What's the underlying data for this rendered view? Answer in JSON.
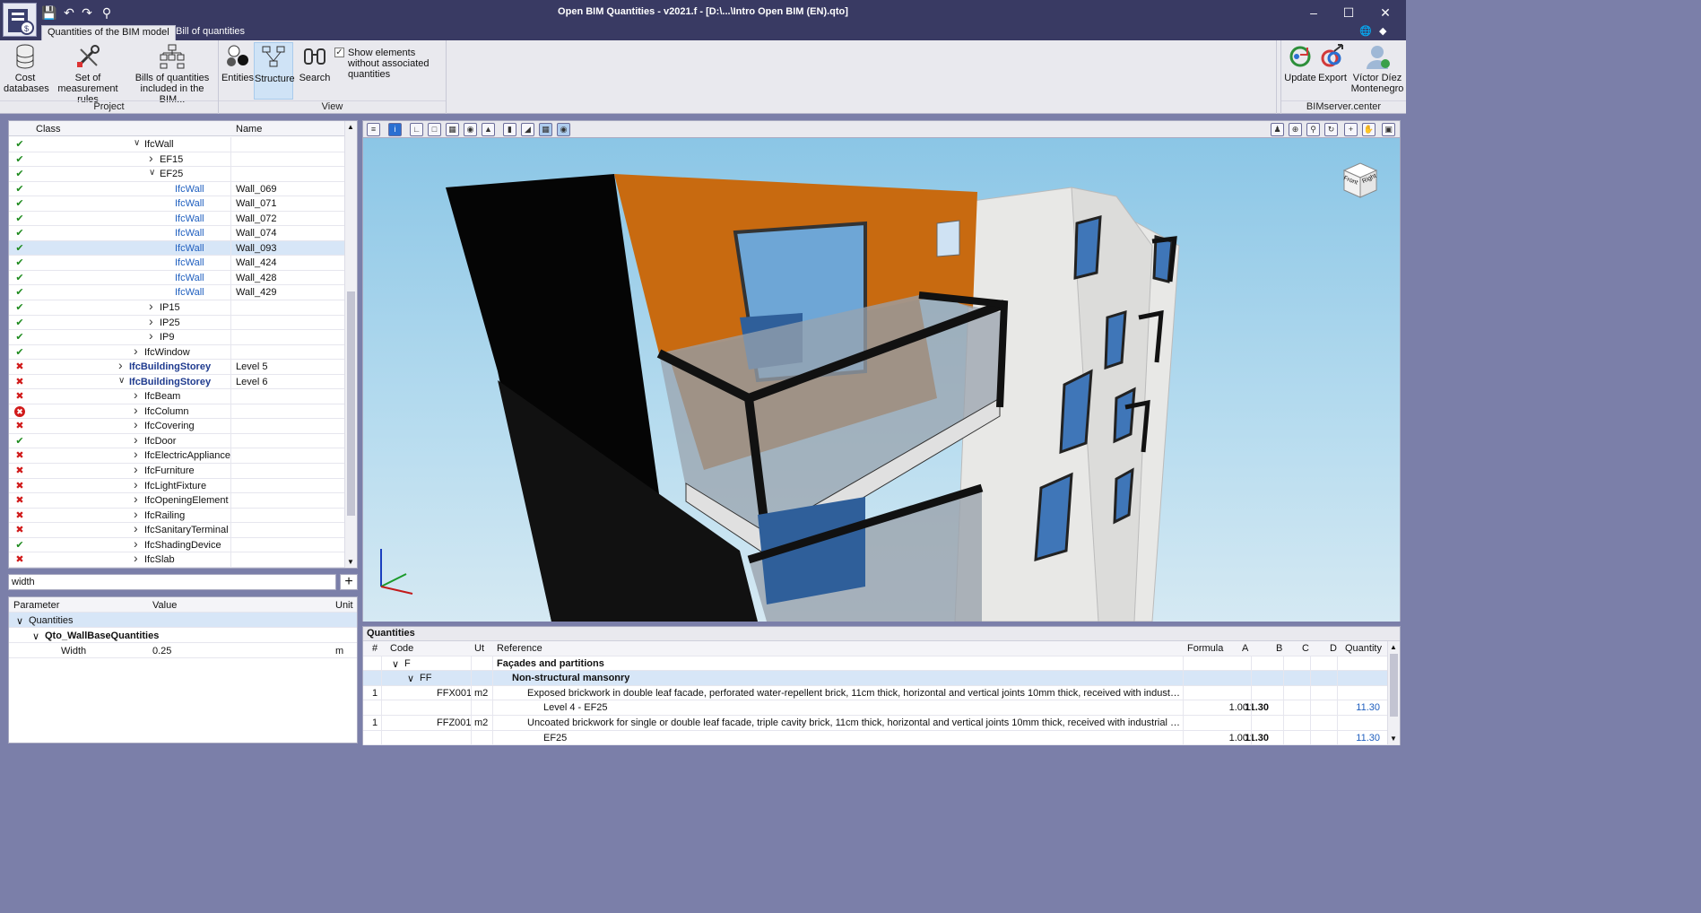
{
  "app": {
    "title": "Open BIM Quantities - v2021.f - [D:\\...\\Intro Open BIM (EN).qto]",
    "window_controls": [
      "minimize-icon",
      "maximize-icon",
      "close-icon"
    ]
  },
  "tabs": [
    {
      "label": "Quantities of the BIM model",
      "active": true
    },
    {
      "label": "Bill of quantities",
      "active": false
    }
  ],
  "ribbon": {
    "project": {
      "label": "Project",
      "buttons": [
        {
          "label": "Cost databases",
          "icon": "database-icon"
        },
        {
          "label": "Set of measurement rules",
          "icon": "tools-icon"
        },
        {
          "label": "Bills of quantities included in the BIM...",
          "icon": "bill-structure-icon"
        }
      ]
    },
    "view": {
      "label": "View",
      "buttons": [
        {
          "label": "Entities",
          "icon": "entities-icon"
        },
        {
          "label": "Structure",
          "icon": "structure-icon",
          "active": true
        },
        {
          "label": "Search",
          "icon": "binoculars-icon"
        }
      ],
      "show_without_quantities": {
        "label": "Show elements without associated quantities",
        "checked": true
      }
    },
    "bimserver": {
      "label": "BIMserver.center",
      "buttons": [
        {
          "label": "Update",
          "icon": "update-icon"
        },
        {
          "label": "Export",
          "icon": "export-icon"
        },
        {
          "label": "Víctor Díez Montenegro",
          "icon": "user-icon"
        }
      ]
    }
  },
  "tree": {
    "headers": {
      "class": "Class",
      "name": "Name"
    },
    "rows": [
      {
        "status": "ok",
        "level": 6,
        "arrow": "down",
        "cls": "IfcWall",
        "name": "",
        "style": "normal"
      },
      {
        "status": "ok",
        "level": 7,
        "arrow": "right",
        "cls": "EF15",
        "name": "",
        "style": "normal"
      },
      {
        "status": "ok",
        "level": 7,
        "arrow": "down",
        "cls": "EF25",
        "name": "",
        "style": "normal"
      },
      {
        "status": "ok",
        "level": 8,
        "arrow": "",
        "cls": "IfcWall",
        "name": "Wall_069",
        "style": "link"
      },
      {
        "status": "ok",
        "level": 8,
        "arrow": "",
        "cls": "IfcWall",
        "name": "Wall_071",
        "style": "link"
      },
      {
        "status": "ok",
        "level": 8,
        "arrow": "",
        "cls": "IfcWall",
        "name": "Wall_072",
        "style": "link"
      },
      {
        "status": "ok",
        "level": 8,
        "arrow": "",
        "cls": "IfcWall",
        "name": "Wall_074",
        "style": "link"
      },
      {
        "status": "ok",
        "level": 8,
        "arrow": "",
        "cls": "IfcWall",
        "name": "Wall_093",
        "style": "link",
        "selected": true
      },
      {
        "status": "ok",
        "level": 8,
        "arrow": "",
        "cls": "IfcWall",
        "name": "Wall_424",
        "style": "link"
      },
      {
        "status": "ok",
        "level": 8,
        "arrow": "",
        "cls": "IfcWall",
        "name": "Wall_428",
        "style": "link"
      },
      {
        "status": "ok",
        "level": 8,
        "arrow": "",
        "cls": "IfcWall",
        "name": "Wall_429",
        "style": "link"
      },
      {
        "status": "ok",
        "level": 7,
        "arrow": "right",
        "cls": "IP15",
        "name": "",
        "style": "normal"
      },
      {
        "status": "ok",
        "level": 7,
        "arrow": "right",
        "cls": "IP25",
        "name": "",
        "style": "normal"
      },
      {
        "status": "ok",
        "level": 7,
        "arrow": "right",
        "cls": "IP9",
        "name": "",
        "style": "normal"
      },
      {
        "status": "ok",
        "level": 6,
        "arrow": "right",
        "cls": "IfcWindow",
        "name": "",
        "style": "normal"
      },
      {
        "status": "no",
        "level": 5,
        "arrow": "right",
        "cls": "IfcBuildingStorey",
        "name": "Level 5",
        "style": "bold"
      },
      {
        "status": "no",
        "level": 5,
        "arrow": "down",
        "cls": "IfcBuildingStorey",
        "name": "Level 6",
        "style": "bold"
      },
      {
        "status": "no",
        "level": 6,
        "arrow": "right",
        "cls": "IfcBeam",
        "name": "",
        "style": "normal"
      },
      {
        "status": "err",
        "level": 6,
        "arrow": "right",
        "cls": "IfcColumn",
        "name": "",
        "style": "normal"
      },
      {
        "status": "no",
        "level": 6,
        "arrow": "right",
        "cls": "IfcCovering",
        "name": "",
        "style": "normal"
      },
      {
        "status": "ok",
        "level": 6,
        "arrow": "right",
        "cls": "IfcDoor",
        "name": "",
        "style": "normal"
      },
      {
        "status": "no",
        "level": 6,
        "arrow": "right",
        "cls": "IfcElectricAppliance",
        "name": "",
        "style": "normal"
      },
      {
        "status": "no",
        "level": 6,
        "arrow": "right",
        "cls": "IfcFurniture",
        "name": "",
        "style": "normal"
      },
      {
        "status": "no",
        "level": 6,
        "arrow": "right",
        "cls": "IfcLightFixture",
        "name": "",
        "style": "normal"
      },
      {
        "status": "no",
        "level": 6,
        "arrow": "right",
        "cls": "IfcOpeningElement",
        "name": "",
        "style": "normal"
      },
      {
        "status": "no",
        "level": 6,
        "arrow": "right",
        "cls": "IfcRailing",
        "name": "",
        "style": "normal"
      },
      {
        "status": "no",
        "level": 6,
        "arrow": "right",
        "cls": "IfcSanitaryTerminal",
        "name": "",
        "style": "normal"
      },
      {
        "status": "ok",
        "level": 6,
        "arrow": "right",
        "cls": "IfcShadingDevice",
        "name": "",
        "style": "normal"
      },
      {
        "status": "no",
        "level": 6,
        "arrow": "right",
        "cls": "IfcSlab",
        "name": "",
        "style": "normal"
      }
    ]
  },
  "filter": {
    "value": "width"
  },
  "params": {
    "headers": {
      "parameter": "Parameter",
      "value": "Value",
      "unit": "Unit"
    },
    "rows": [
      {
        "parameter": "Quantities",
        "value": "",
        "unit": "",
        "level": 0,
        "arrow": "down",
        "highlight": true
      },
      {
        "parameter": "Qto_WallBaseQuantities",
        "value": "",
        "unit": "",
        "level": 1,
        "arrow": "down",
        "highlight": false
      },
      {
        "parameter": "Width",
        "value": "0.25",
        "unit": "m",
        "level": 2,
        "arrow": "",
        "highlight": false
      }
    ]
  },
  "view_cube": {
    "faces": [
      "Front",
      "Right"
    ]
  },
  "quantities": {
    "title": "Quantities",
    "headers": {
      "n": "#",
      "code": "Code",
      "ut": "Ut",
      "reference": "Reference",
      "formula": "Formula",
      "a": "A",
      "b": "B",
      "c": "C",
      "d": "D",
      "quantity": "Quantity"
    },
    "rows": [
      {
        "n": "",
        "code": "F",
        "ut": "",
        "reference": "Façades and partitions",
        "a": "",
        "b": "",
        "quantity": "",
        "indent": 0,
        "arrow": "down",
        "highlight": false
      },
      {
        "n": "",
        "code": "FF",
        "ut": "",
        "reference": "Non-structural mansonry",
        "a": "",
        "b": "",
        "quantity": "",
        "indent": 1,
        "arrow": "down",
        "highlight": true
      },
      {
        "n": "1",
        "code": "FFX001",
        "ut": "m2",
        "reference": "Exposed brickwork in double leaf facade, perforated water-repellent brick, 11cm thick, horizontal and vertical joints 10mm thick, received with industrial cement mo...",
        "a": "",
        "b": "",
        "quantity": "",
        "indent": 2,
        "arrow": "",
        "highlight": false
      },
      {
        "n": "",
        "code": "",
        "ut": "",
        "reference": "Level 4 - EF25",
        "a": "1.00",
        "b": "11.30",
        "quantity": "11.30",
        "indent": 3,
        "arrow": "",
        "highlight": false
      },
      {
        "n": "1",
        "code": "FFZ001",
        "ut": "m2",
        "reference": "Uncoated brickwork for single or double leaf facade, triple cavity brick, 11cm thick, horizontal and vertical joints 10mm thick, received with industrial cement mortar,...",
        "a": "",
        "b": "",
        "quantity": "",
        "indent": 2,
        "arrow": "",
        "highlight": false
      },
      {
        "n": "",
        "code": "",
        "ut": "",
        "reference": "EF25",
        "a": "1.00",
        "b": "11.30",
        "quantity": "11.30",
        "indent": 3,
        "arrow": "",
        "highlight": false
      }
    ]
  },
  "colors": {
    "titlebar": "#393a63",
    "ok": "#1d8a1d",
    "error": "#d11a1a",
    "link": "#1f5fbf",
    "selection": "#d7e6f7",
    "orange_wall": "#c86a10"
  }
}
